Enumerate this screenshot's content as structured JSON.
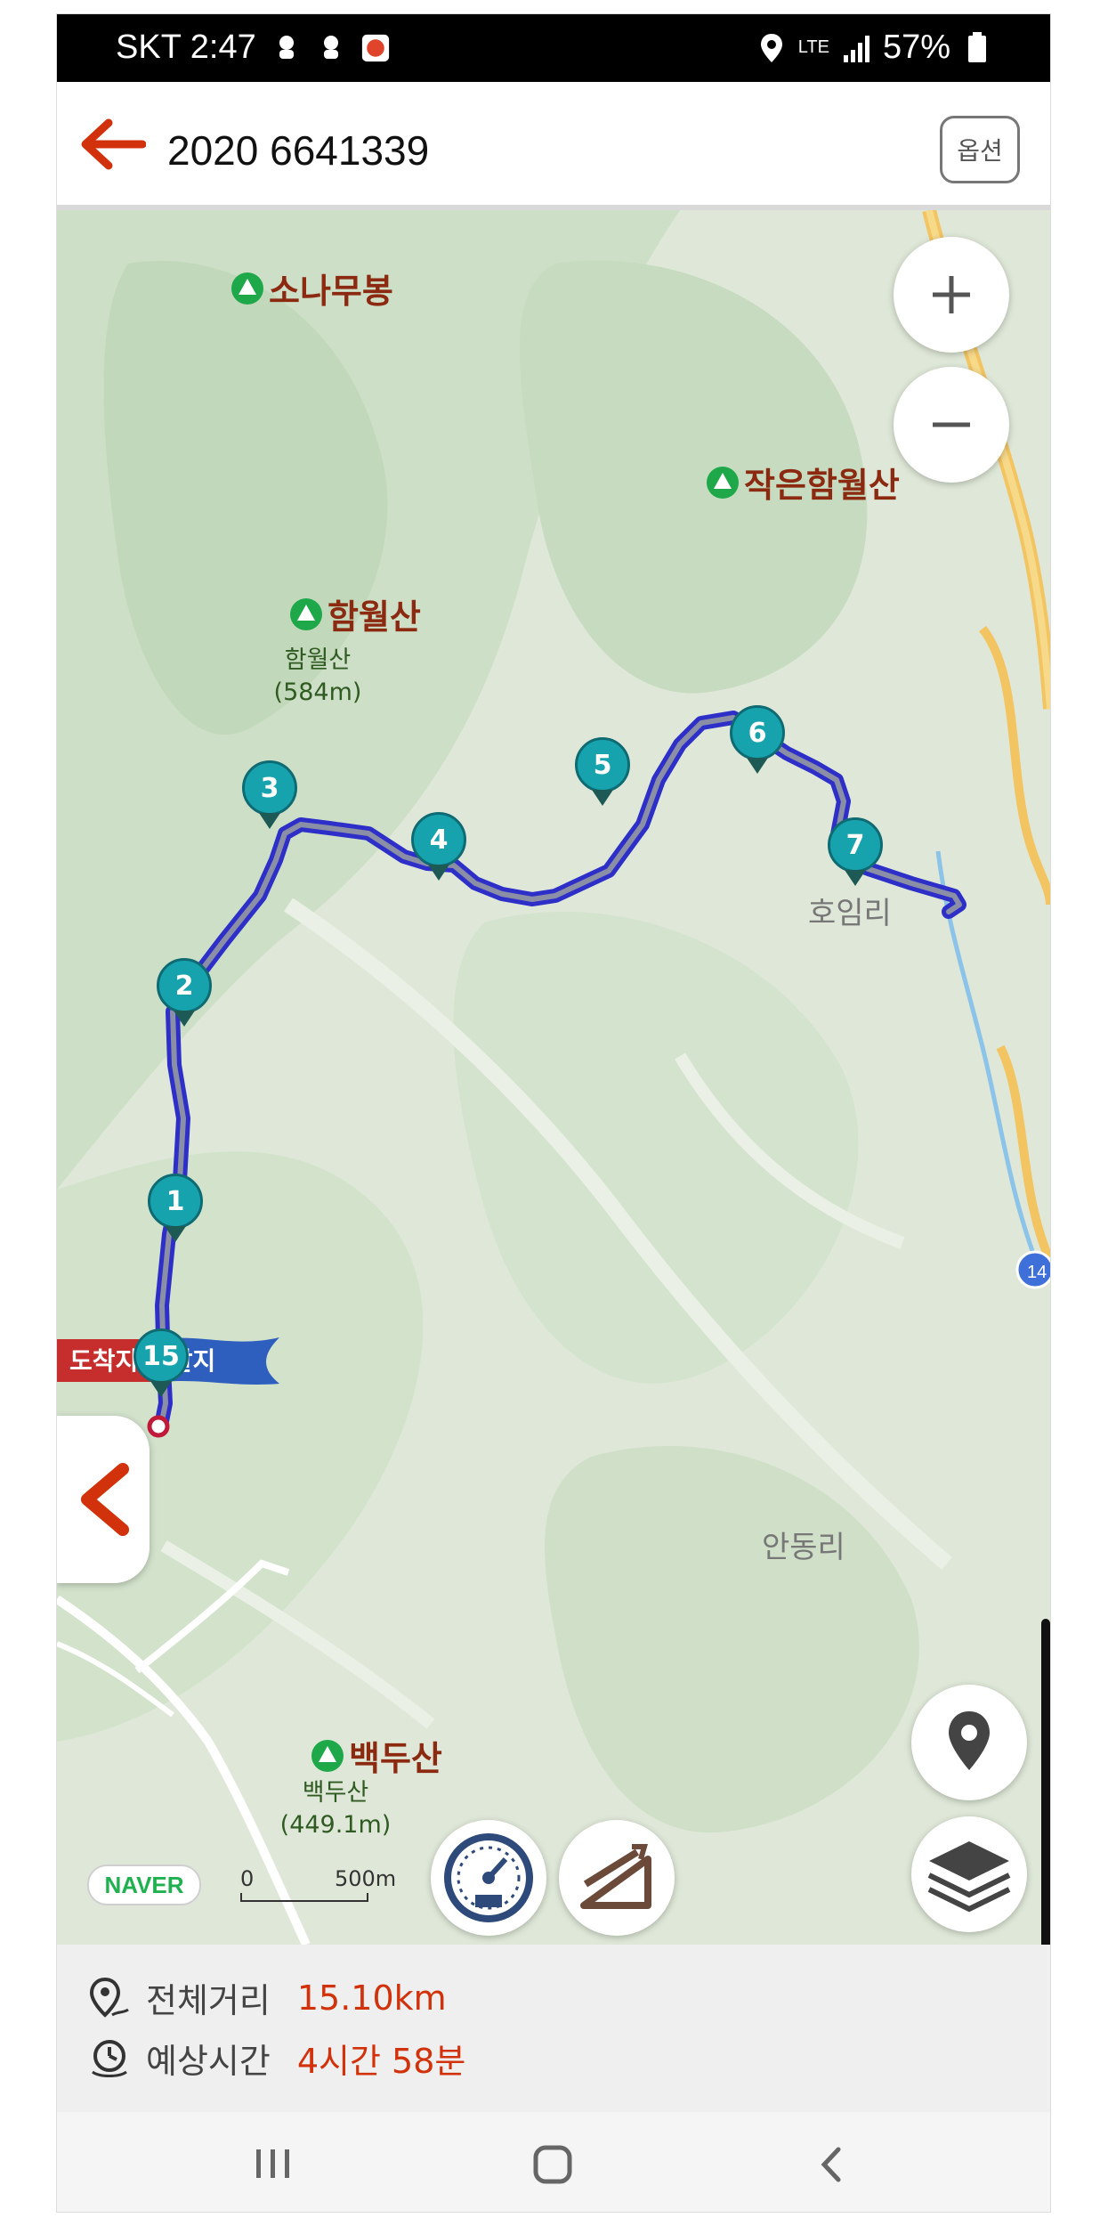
{
  "status_bar": {
    "carrier_time": "SKT 2:47",
    "network": "LTE",
    "battery": "57%"
  },
  "header": {
    "title": "2020 6641339",
    "option_label": "옵션"
  },
  "map": {
    "peaks": [
      {
        "name": "소나무봉"
      },
      {
        "name": "작은함월산"
      },
      {
        "name": "함월산",
        "sub_name": "함월산",
        "sub_height": "(584m)"
      },
      {
        "name": "백두산",
        "sub_name": "백두산",
        "sub_height": "(449.1m)"
      }
    ],
    "villages": [
      "호임리",
      "안동리"
    ],
    "waypoints": [
      "1",
      "2",
      "3",
      "4",
      "5",
      "6",
      "7",
      "15"
    ],
    "flag_text": "도착지 출발지",
    "road_badge": "14",
    "provider": "NAVER",
    "scale": {
      "start": "0",
      "end": "500m"
    },
    "route_color": "#2d2fc8",
    "accent_color": "#d2320b"
  },
  "info": {
    "distance_label": "전체거리",
    "distance_value": "15.10km",
    "time_label": "예상시간",
    "time_value": "4시간 58분"
  },
  "icons": [
    "back-arrow-icon",
    "zoom-in-icon",
    "zoom-out-icon",
    "collapse-chevron-icon",
    "speedometer-icon",
    "slope-icon",
    "location-pin-icon",
    "layers-icon",
    "distance-pin-icon",
    "clock-icon"
  ]
}
